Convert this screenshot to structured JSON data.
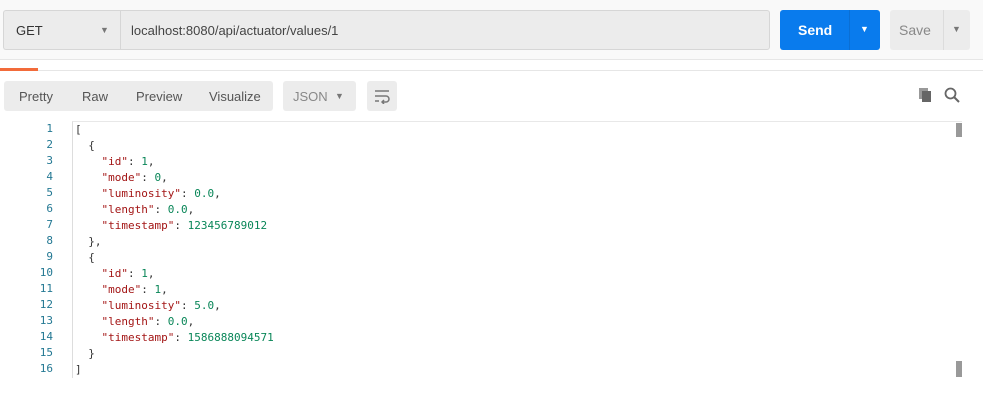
{
  "request": {
    "method": "GET",
    "url": "localhost:8080/api/actuator/values/1",
    "send_label": "Send",
    "save_label": "Save"
  },
  "response": {
    "view_tabs": [
      "Pretty",
      "Raw",
      "Preview",
      "Visualize"
    ],
    "format": "JSON",
    "lines": [
      [
        [
          "p",
          "["
        ]
      ],
      [
        [
          "p",
          "  {"
        ]
      ],
      [
        [
          "p",
          "    "
        ],
        [
          "k",
          "\"id\""
        ],
        [
          "p",
          ": "
        ],
        [
          "n",
          "1"
        ],
        [
          "p",
          ","
        ]
      ],
      [
        [
          "p",
          "    "
        ],
        [
          "k",
          "\"mode\""
        ],
        [
          "p",
          ": "
        ],
        [
          "n",
          "0"
        ],
        [
          "p",
          ","
        ]
      ],
      [
        [
          "p",
          "    "
        ],
        [
          "k",
          "\"luminosity\""
        ],
        [
          "p",
          ": "
        ],
        [
          "n",
          "0.0"
        ],
        [
          "p",
          ","
        ]
      ],
      [
        [
          "p",
          "    "
        ],
        [
          "k",
          "\"length\""
        ],
        [
          "p",
          ": "
        ],
        [
          "n",
          "0.0"
        ],
        [
          "p",
          ","
        ]
      ],
      [
        [
          "p",
          "    "
        ],
        [
          "k",
          "\"timestamp\""
        ],
        [
          "p",
          ": "
        ],
        [
          "n",
          "123456789012"
        ]
      ],
      [
        [
          "p",
          "  },"
        ]
      ],
      [
        [
          "p",
          "  {"
        ]
      ],
      [
        [
          "p",
          "    "
        ],
        [
          "k",
          "\"id\""
        ],
        [
          "p",
          ": "
        ],
        [
          "n",
          "1"
        ],
        [
          "p",
          ","
        ]
      ],
      [
        [
          "p",
          "    "
        ],
        [
          "k",
          "\"mode\""
        ],
        [
          "p",
          ": "
        ],
        [
          "n",
          "1"
        ],
        [
          "p",
          ","
        ]
      ],
      [
        [
          "p",
          "    "
        ],
        [
          "k",
          "\"luminosity\""
        ],
        [
          "p",
          ": "
        ],
        [
          "n",
          "5.0"
        ],
        [
          "p",
          ","
        ]
      ],
      [
        [
          "p",
          "    "
        ],
        [
          "k",
          "\"length\""
        ],
        [
          "p",
          ": "
        ],
        [
          "n",
          "0.0"
        ],
        [
          "p",
          ","
        ]
      ],
      [
        [
          "p",
          "    "
        ],
        [
          "k",
          "\"timestamp\""
        ],
        [
          "p",
          ": "
        ],
        [
          "n",
          "1586888094571"
        ]
      ],
      [
        [
          "p",
          "  }"
        ]
      ],
      [
        [
          "p",
          "]"
        ]
      ]
    ]
  }
}
